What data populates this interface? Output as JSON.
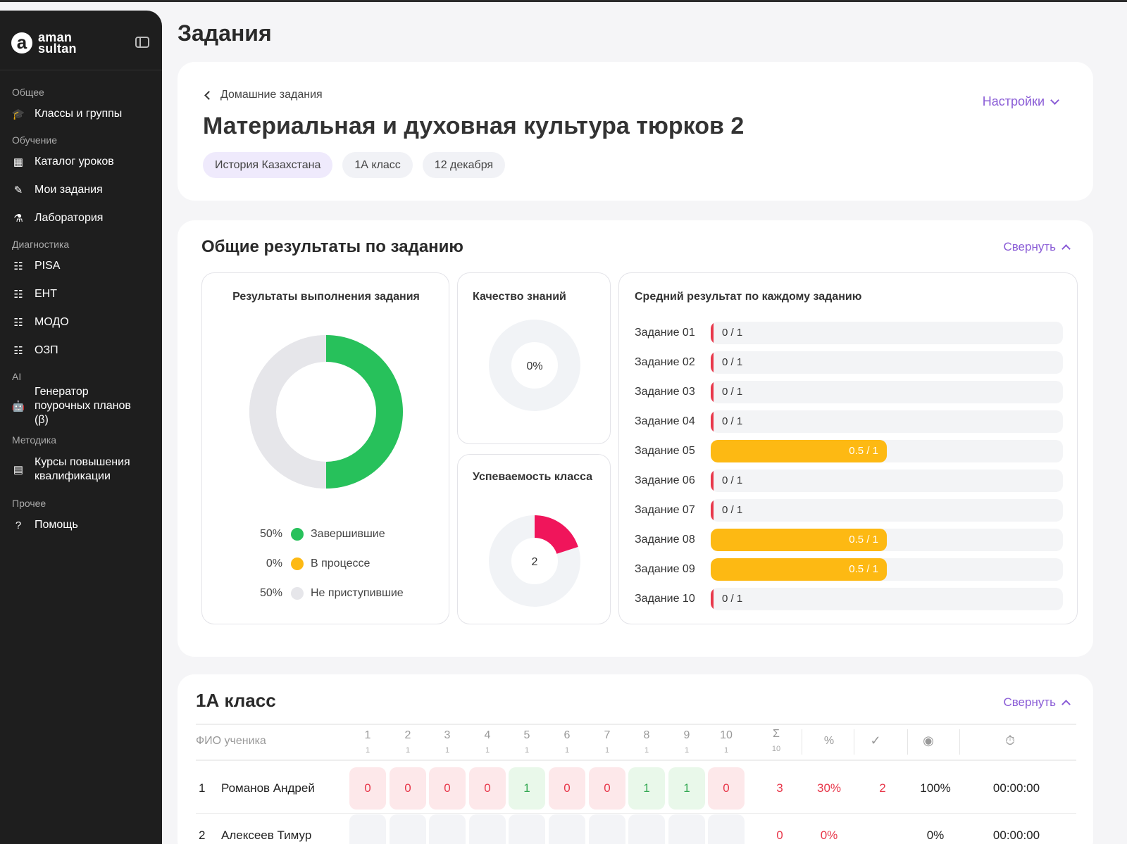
{
  "sidebar": {
    "logo": {
      "mark": "a",
      "line1": "aman",
      "line2": "sultan"
    },
    "sections": [
      {
        "title": "Общее",
        "items": [
          {
            "label": "Классы и группы",
            "icon": "graduation-cap-icon"
          }
        ]
      },
      {
        "title": "Обучение",
        "items": [
          {
            "label": "Каталог уроков",
            "icon": "grid-icon"
          },
          {
            "label": "Мои задания",
            "icon": "edit-icon"
          },
          {
            "label": "Лаборатория",
            "icon": "flask-icon"
          }
        ]
      },
      {
        "title": "Диагностика",
        "items": [
          {
            "label": "PISA",
            "icon": "checklist-icon"
          },
          {
            "label": "ЕНТ",
            "icon": "checklist-icon"
          },
          {
            "label": "МОДО",
            "icon": "checklist-icon"
          },
          {
            "label": "ОЗП",
            "icon": "checklist-icon"
          }
        ]
      },
      {
        "title": "AI",
        "items": [
          {
            "label": "Генератор поурочных планов (β)",
            "icon": "robot-icon"
          }
        ]
      },
      {
        "title": "Методика",
        "items": [
          {
            "label": "Курсы повышения квалификации",
            "icon": "book-icon"
          }
        ]
      },
      {
        "title": "Прочее",
        "items": [
          {
            "label": "Помощь",
            "icon": "help-icon"
          }
        ]
      }
    ]
  },
  "page": {
    "title": "Задания"
  },
  "header": {
    "back_label": "Домашние задания",
    "settings_label": "Настройки",
    "title": "Материальная и духовная культура тюрков 2",
    "tags": [
      "История Казахстана",
      "1А класс",
      "12 декабря"
    ]
  },
  "results": {
    "title": "Общие результаты по заданию",
    "collapse_label": "Свернуть",
    "completion": {
      "title": "Результаты выполнения задания",
      "legend": [
        {
          "value": "50%",
          "label": "Завершившие",
          "color": "#27c15b"
        },
        {
          "value": "0%",
          "label": "В процессе",
          "color": "#fdb913"
        },
        {
          "value": "50%",
          "label": "Не приступившие",
          "color": "#e6e6ea"
        }
      ]
    },
    "quality": {
      "title": "Качество знаний",
      "value": "0%"
    },
    "performance": {
      "title": "Успеваемость класса",
      "value": "2"
    },
    "average": {
      "title": "Средний результат по каждому заданию"
    }
  },
  "chart_data": [
    {
      "type": "pie",
      "title": "Результаты выполнения задания",
      "categories": [
        "Завершившие",
        "В процессе",
        "Не приступившие"
      ],
      "values": [
        50,
        0,
        50
      ],
      "colors": [
        "#27c15b",
        "#fdb913",
        "#e6e6ea"
      ]
    },
    {
      "type": "pie",
      "title": "Качество знаний",
      "values": [
        0
      ]
    },
    {
      "type": "pie",
      "title": "Успеваемость класса",
      "value": 2,
      "filled_fraction": 0.2
    },
    {
      "type": "bar",
      "title": "Средний результат по каждому заданию",
      "categories": [
        "Задание 01",
        "Задание 02",
        "Задание 03",
        "Задание 04",
        "Задание 05",
        "Задание 06",
        "Задание 07",
        "Задание 08",
        "Задание 09",
        "Задание 10"
      ],
      "values": [
        0,
        0,
        0,
        0,
        0.5,
        0,
        0,
        0.5,
        0.5,
        0
      ],
      "max": 1,
      "labels": [
        "0 / 1",
        "0 / 1",
        "0 / 1",
        "0 / 1",
        "0.5 / 1",
        "0 / 1",
        "0 / 1",
        "0.5 / 1",
        "0.5 / 1",
        "0 / 1"
      ]
    }
  ],
  "class_table": {
    "title": "1А класс",
    "collapse_label": "Свернуть",
    "name_header": "ФИО ученика",
    "task_headers": [
      {
        "n": "1",
        "max": "1"
      },
      {
        "n": "2",
        "max": "1"
      },
      {
        "n": "3",
        "max": "1"
      },
      {
        "n": "4",
        "max": "1"
      },
      {
        "n": "5",
        "max": "1"
      },
      {
        "n": "6",
        "max": "1"
      },
      {
        "n": "7",
        "max": "1"
      },
      {
        "n": "8",
        "max": "1"
      },
      {
        "n": "9",
        "max": "1"
      },
      {
        "n": "10",
        "max": "1"
      }
    ],
    "sum_header": {
      "symbol": "Σ",
      "max": "10"
    },
    "percent_header": "%",
    "rows": [
      {
        "num": "1",
        "name": "Романов Андрей",
        "scores": [
          "0",
          "0",
          "0",
          "0",
          "1",
          "0",
          "0",
          "1",
          "1",
          "0"
        ],
        "sum": "3",
        "percent": "30%",
        "checked": "2",
        "viewed": "100%",
        "time": "00:00:00"
      },
      {
        "num": "2",
        "name": "Алексеев Тимур",
        "scores": [
          "",
          "",
          "",
          "",
          "",
          "",
          "",
          "",
          "",
          ""
        ],
        "sum": "0",
        "percent": "0%",
        "checked": "",
        "viewed": "0%",
        "time": "00:00:00"
      }
    ]
  }
}
